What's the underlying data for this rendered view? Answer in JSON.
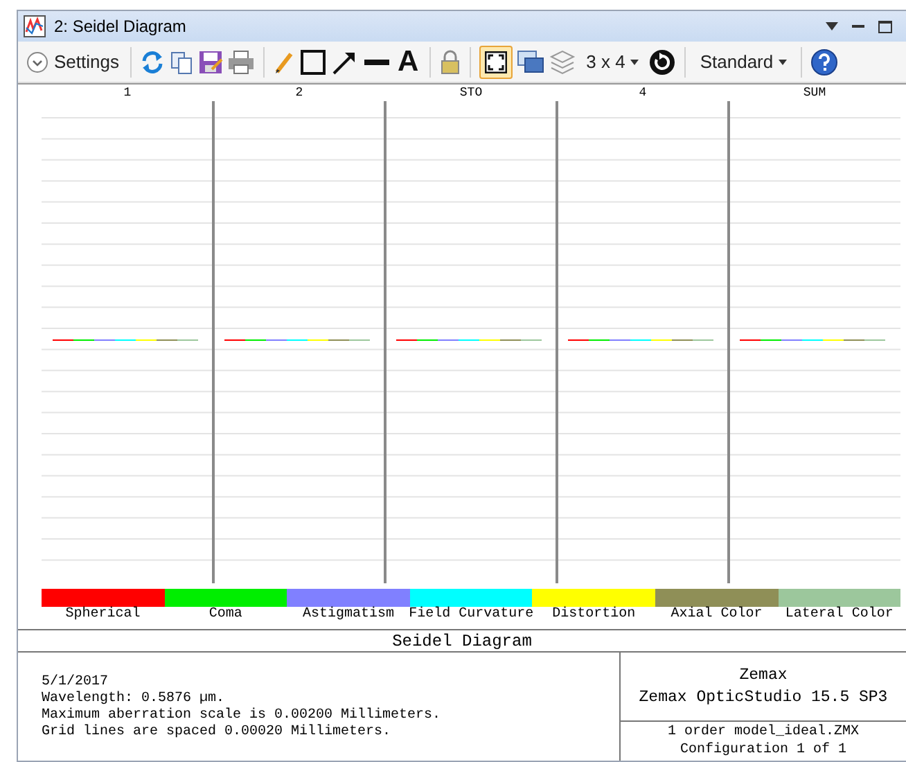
{
  "window": {
    "title": "2: Seidel Diagram"
  },
  "toolbar": {
    "settings_label": "Settings",
    "text_tool": "A",
    "fit_selected": true,
    "grid_label": "3 x 4",
    "mode_label": "Standard"
  },
  "columns": [
    "1",
    "2",
    "STO",
    "4",
    "SUM"
  ],
  "legend": [
    {
      "label": "Spherical",
      "color": "#ff0000"
    },
    {
      "label": "Coma",
      "color": "#00ee00"
    },
    {
      "label": "Astigmatism",
      "color": "#8080ff"
    },
    {
      "label": "Field Curvature",
      "color": "#00ffff"
    },
    {
      "label": "Distortion",
      "color": "#ffff00"
    },
    {
      "label": "Axial Color",
      "color": "#8f8f57"
    },
    {
      "label": "Lateral Color",
      "color": "#9cc79c"
    }
  ],
  "footer": {
    "title": "Seidel Diagram",
    "notes": [
      "5/1/2017",
      "Wavelength: 0.5876 µm.",
      "Maximum aberration scale is 0.00200 Millimeters.",
      "Grid lines are spaced 0.00020 Millimeters."
    ],
    "company": [
      "Zemax",
      "Zemax OpticStudio 15.5 SP3"
    ],
    "file": [
      "1 order model_ideal.ZMX",
      "Configuration 1 of 1"
    ]
  }
}
